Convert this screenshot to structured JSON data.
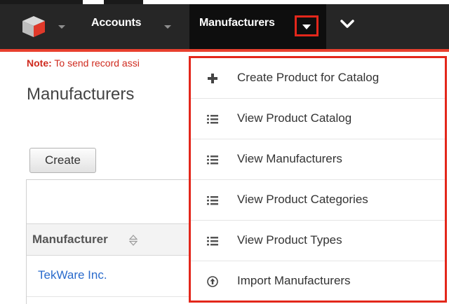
{
  "navbar": {
    "logo_icon": "cube-logo-icon",
    "accounts_label": "Accounts",
    "manufacturers_label": "Manufacturers",
    "dropdown_toggle_icon": "caret-down-icon",
    "more_icon": "chevron-down-icon",
    "accent_color": "#e8402e"
  },
  "page": {
    "note_prefix": "Note:",
    "note_text": " To send record assi",
    "title": "Manufacturers",
    "create_label": "Create"
  },
  "table": {
    "column_header": "Manufacturer",
    "sort_icon": "sort-icon",
    "rows": [
      "TekWare Inc."
    ]
  },
  "menu": {
    "items": [
      {
        "icon": "plus-icon",
        "label": "Create Product for Catalog"
      },
      {
        "icon": "list-icon",
        "label": "View Product Catalog"
      },
      {
        "icon": "list-icon",
        "label": "View Manufacturers"
      },
      {
        "icon": "list-icon",
        "label": "View Product Categories"
      },
      {
        "icon": "list-icon",
        "label": "View Product Types"
      },
      {
        "icon": "upload-circle-icon",
        "label": "Import Manufacturers"
      }
    ]
  }
}
